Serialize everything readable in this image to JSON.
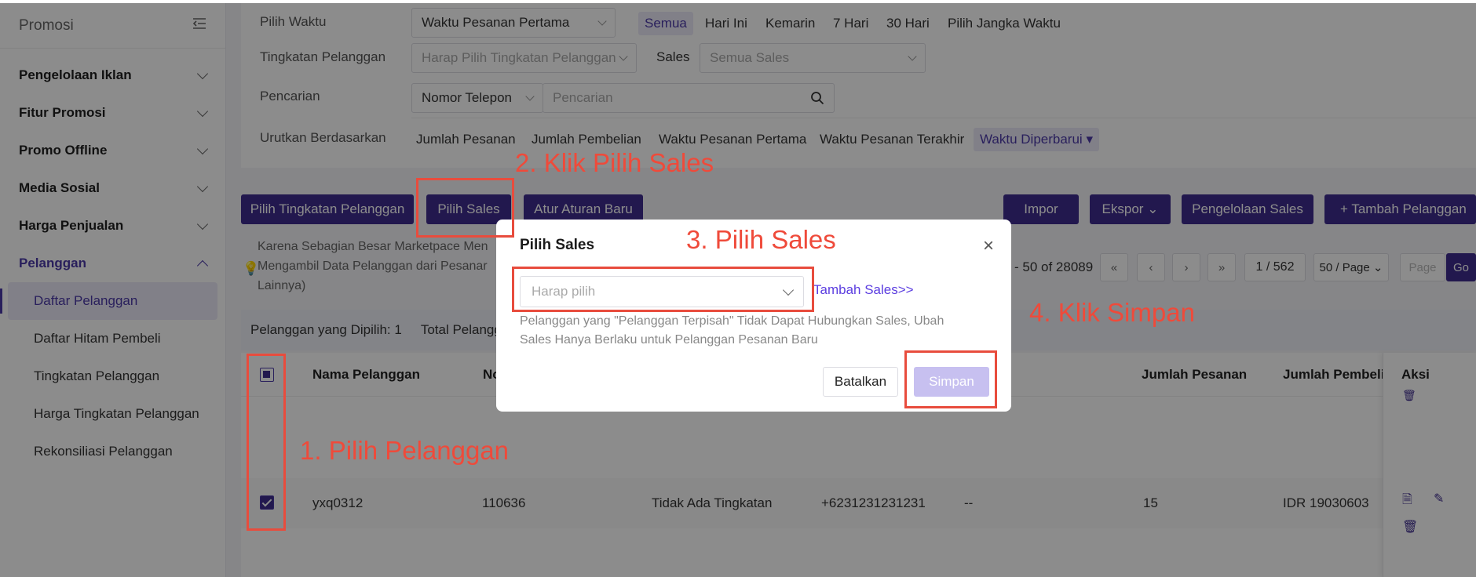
{
  "sidebar": {
    "title": "Promosi",
    "menu": [
      {
        "label": "Pengelolaan Iklan"
      },
      {
        "label": "Fitur Promosi"
      },
      {
        "label": "Promo Offline"
      },
      {
        "label": "Media Sosial"
      },
      {
        "label": "Harga Penjualan"
      },
      {
        "label": "Pelanggan"
      }
    ],
    "submenu": [
      {
        "label": "Daftar Pelanggan"
      },
      {
        "label": "Daftar Hitam Pembeli"
      },
      {
        "label": "Tingkatan Pelanggan"
      },
      {
        "label": "Harga Tingkatan Pelanggan"
      },
      {
        "label": "Rekonsiliasi Pelanggan"
      }
    ]
  },
  "filters": {
    "time_label": "Pilih Waktu",
    "time_select": "Waktu Pesanan Pertama",
    "time_options": [
      "Semua",
      "Hari Ini",
      "Kemarin",
      "7 Hari",
      "30 Hari",
      "Pilih Jangka Waktu"
    ],
    "level_label": "Tingkatan Pelanggan",
    "level_placeholder": "Harap Pilih Tingkatan Pelanggan",
    "sales_label": "Sales",
    "sales_select": "Semua Sales",
    "search_label": "Pencarian",
    "search_type": "Nomor Telepon",
    "search_placeholder": "Pencarian",
    "sort_label": "Urutkan Berdasarkan",
    "sort_options": [
      "Jumlah Pesanan",
      "Jumlah Pembelian",
      "Waktu Pesanan Pertama",
      "Waktu Pesanan Terakhir",
      "Waktu Diperbarui"
    ]
  },
  "toolbar": {
    "set_level": "Pilih Tingkatan Pelanggan",
    "pick_sales": "Pilih Sales",
    "new_rule": "Atur Aturan Baru",
    "import": "Impor",
    "export": "Ekspor",
    "sales_mgmt": "Pengelolaan Sales",
    "add_customer": "+ Tambah Pelanggan"
  },
  "notice": {
    "line1": "Karena Sebagian Besar Marketpace Men",
    "line2": "Mengambil Data Pelanggan dari Pesanar",
    "line3": "Lainnya)"
  },
  "pagination": {
    "range": "- 50 of 28089",
    "page": "1 / 562",
    "per_page": "50 / Page",
    "page_placeholder": "Page",
    "go": "Go"
  },
  "table": {
    "selected_text": "Pelanggan yang Dipilih: 1",
    "total_text": "Total Pelangg",
    "headers": {
      "name": "Nama Pelanggan",
      "no": "No",
      "orders": "Jumlah Pesanan",
      "purchases": "Jumlah Pembelia",
      "actions": "Aksi"
    },
    "row": {
      "name": "yxq0312",
      "no": "110636",
      "level": "Tidak Ada Tingkatan",
      "phone": "+6231231231231",
      "sales": "--",
      "orders": "15",
      "purchases": "IDR 19030603"
    }
  },
  "modal": {
    "title": "Pilih Sales",
    "select_placeholder": "Harap pilih",
    "add_link": "Tambah Sales>>",
    "note": "Pelanggan yang \"Pelanggan Terpisah\" Tidak Dapat Hubungkan Sales, Ubah Sales Hanya Berlaku untuk Pelanggan Pesanan Baru",
    "cancel": "Batalkan",
    "save": "Simpan"
  },
  "annotations": {
    "step1": "1. Pilih Pelanggan",
    "step2": "2. Klik Pilih Sales",
    "step3": "3. Pilih Sales",
    "step4": "4. Klik Simpan"
  },
  "colors": {
    "primary": "#3f2d8f",
    "annotation": "#e84c3d",
    "link": "#5b3de0"
  }
}
